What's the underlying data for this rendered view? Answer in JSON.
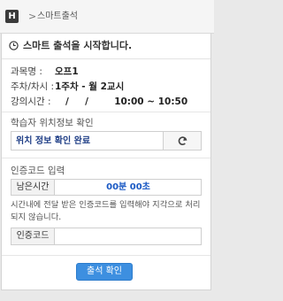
{
  "topbar": {
    "home_icon_glyph": "H",
    "separator": ">",
    "breadcrumb": "스마트출석"
  },
  "panel": {
    "header": "스마트 출석을 시작합니다.",
    "course": {
      "label": "과목명 :",
      "value": "오프1"
    },
    "week": {
      "label": "주차/차시 :",
      "value": "1주차 - 월 2교시"
    },
    "time": {
      "label": "강의시간 :",
      "value": "/     /        10:00 ~ 10:50"
    }
  },
  "location": {
    "title": "학습자 위치정보 확인",
    "status": "위치 정보 확인 완료",
    "refresh_icon": "refresh-icon"
  },
  "auth": {
    "title": "인증코드 입력",
    "remaining_label": "남은시간",
    "remaining_value": "00분 00초",
    "notice": "시간내에 전달 받은 인증코드를 입력해야 지각으로 처리되지 않습니다.",
    "code_label": "인증코드",
    "code_value": ""
  },
  "submit_label": "출석 확인",
  "colors": {
    "accent": "#3d8fe0",
    "location_text": "#1f3e86",
    "timer_text": "#1a59c4"
  }
}
